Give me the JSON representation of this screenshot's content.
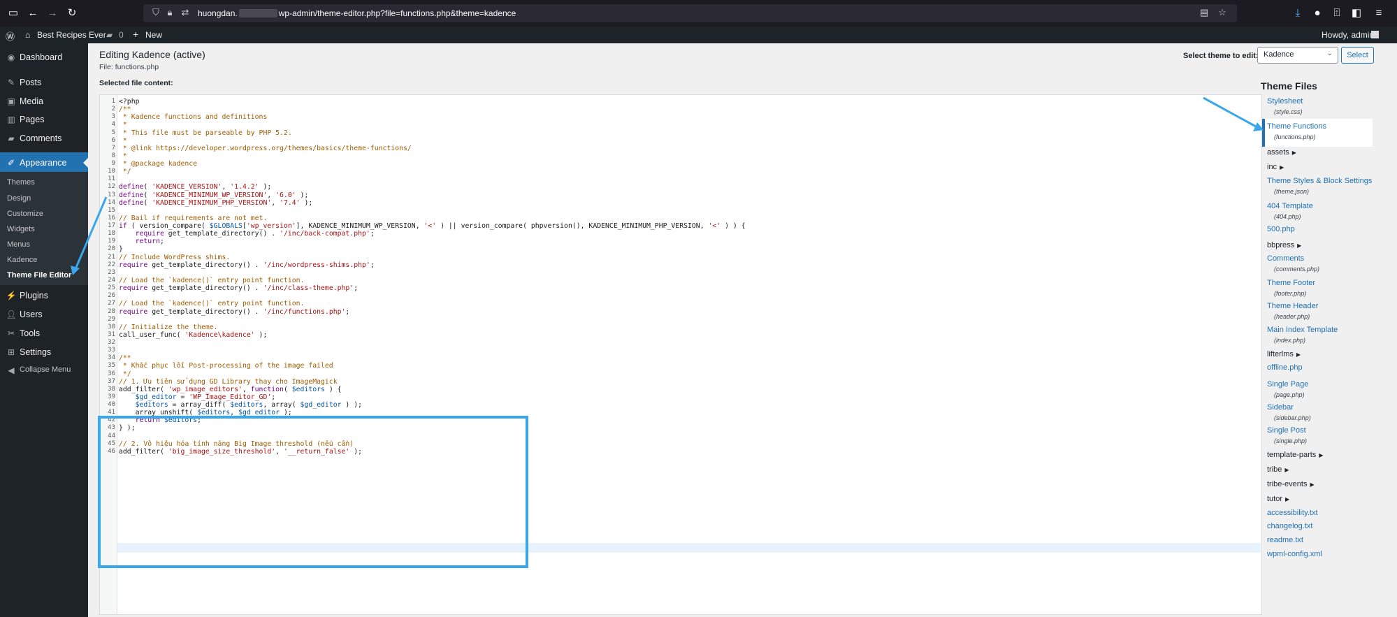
{
  "browser": {
    "url_prefix": "huongdan.",
    "url_suffix": "wp-admin/theme-editor.php?file=functions.php&theme=kadence"
  },
  "adminbar": {
    "site_name": "Best Recipes Ever",
    "comments_count": "0",
    "new_label": "New",
    "howdy": "Howdy, admin"
  },
  "menu": {
    "dashboard": "Dashboard",
    "posts": "Posts",
    "media": "Media",
    "pages": "Pages",
    "comments": "Comments",
    "appearance": "Appearance",
    "submenu": [
      "Themes",
      "Design",
      "Customize",
      "Widgets",
      "Menus",
      "Kadence",
      "Theme File Editor"
    ],
    "plugins": "Plugins",
    "users": "Users",
    "tools": "Tools",
    "settings": "Settings",
    "collapse": "Collapse Menu"
  },
  "header": {
    "title": "Editing Kadence (active)",
    "file_line": "File: functions.php",
    "selected_file_content": "Selected file content:",
    "select_theme_label": "Select theme to edit:",
    "selected_theme": "Kadence",
    "select_button": "Select"
  },
  "code_lines": [
    "<?php",
    "/**",
    " * Kadence functions and definitions",
    " *",
    " * This file must be parseable by PHP 5.2.",
    " *",
    " * @link https://developer.wordpress.org/themes/basics/theme-functions/",
    " *",
    " * @package kadence",
    " */",
    "",
    "define( 'KADENCE_VERSION', '1.4.2' );",
    "define( 'KADENCE_MINIMUM_WP_VERSION', '6.0' );",
    "define( 'KADENCE_MINIMUM_PHP_VERSION', '7.4' );",
    "",
    "// Bail if requirements are not met.",
    "if ( version_compare( $GLOBALS['wp_version'], KADENCE_MINIMUM_WP_VERSION, '<' ) || version_compare( phpversion(), KADENCE_MINIMUM_PHP_VERSION, '<' ) ) {",
    "    require get_template_directory() . '/inc/back-compat.php';",
    "    return;",
    "}",
    "// Include WordPress shims.",
    "require get_template_directory() . '/inc/wordpress-shims.php';",
    "",
    "// Load the `kadence()` entry point function.",
    "require get_template_directory() . '/inc/class-theme.php';",
    "",
    "// Load the `kadence()` entry point function.",
    "require get_template_directory() . '/inc/functions.php';",
    "",
    "// Initialize the theme.",
    "call_user_func( 'Kadence\\kadence' );",
    "",
    "",
    "/**",
    " * Khắc phục lỗi Post-processing of the image failed",
    " */",
    "// 1. Ưu tiên sử dụng GD Library thay cho ImageMagick",
    "add_filter( 'wp_image_editors', function( $editors ) {",
    "    $gd_editor = 'WP_Image_Editor_GD';",
    "    $editors = array_diff( $editors, array( $gd_editor ) );",
    "    array_unshift( $editors, $gd_editor );",
    "    return $editors;",
    "} );",
    "",
    "// 2. Vô hiệu hóa tính năng Big Image threshold (nếu cần)",
    "add_filter( 'big_image_size_threshold', '__return_false' );"
  ],
  "theme_files": {
    "heading": "Theme Files",
    "items": [
      {
        "label": "Stylesheet",
        "file": "(style.css)",
        "type": "file"
      },
      {
        "label": "Theme Functions",
        "file": "(functions.php)",
        "type": "file",
        "current": true
      },
      {
        "label": "assets",
        "type": "folder"
      },
      {
        "label": "inc",
        "type": "folder"
      },
      {
        "label": "Theme Styles & Block Settings",
        "file": "(theme.json)",
        "type": "file"
      },
      {
        "label": "404 Template",
        "file": "(404.php)",
        "type": "file"
      },
      {
        "label": "500.php",
        "type": "file"
      },
      {
        "label": "bbpress",
        "type": "folder"
      },
      {
        "label": "Comments",
        "file": "(comments.php)",
        "type": "file"
      },
      {
        "label": "Theme Footer",
        "file": "(footer.php)",
        "type": "file"
      },
      {
        "label": "Theme Header",
        "file": "(header.php)",
        "type": "file"
      },
      {
        "label": "Main Index Template",
        "file": "(index.php)",
        "type": "file"
      },
      {
        "label": "lifterlms",
        "type": "folder"
      },
      {
        "label": "offline.php",
        "type": "file"
      },
      {
        "label": "Single Page",
        "file": "(page.php)",
        "type": "file"
      },
      {
        "label": "Sidebar",
        "file": "(sidebar.php)",
        "type": "file"
      },
      {
        "label": "Single Post",
        "file": "(single.php)",
        "type": "file"
      },
      {
        "label": "template-parts",
        "type": "folder"
      },
      {
        "label": "tribe",
        "type": "folder"
      },
      {
        "label": "tribe-events",
        "type": "folder"
      },
      {
        "label": "tutor",
        "type": "folder"
      },
      {
        "label": "accessibility.txt",
        "type": "file"
      },
      {
        "label": "changelog.txt",
        "type": "file"
      },
      {
        "label": "readme.txt",
        "type": "file"
      },
      {
        "label": "wpml-config.xml",
        "type": "file"
      }
    ]
  },
  "colors": {
    "accent": "#2271b1",
    "highlight_box": "#3aa7ea",
    "admin_dark": "#1d2327"
  }
}
